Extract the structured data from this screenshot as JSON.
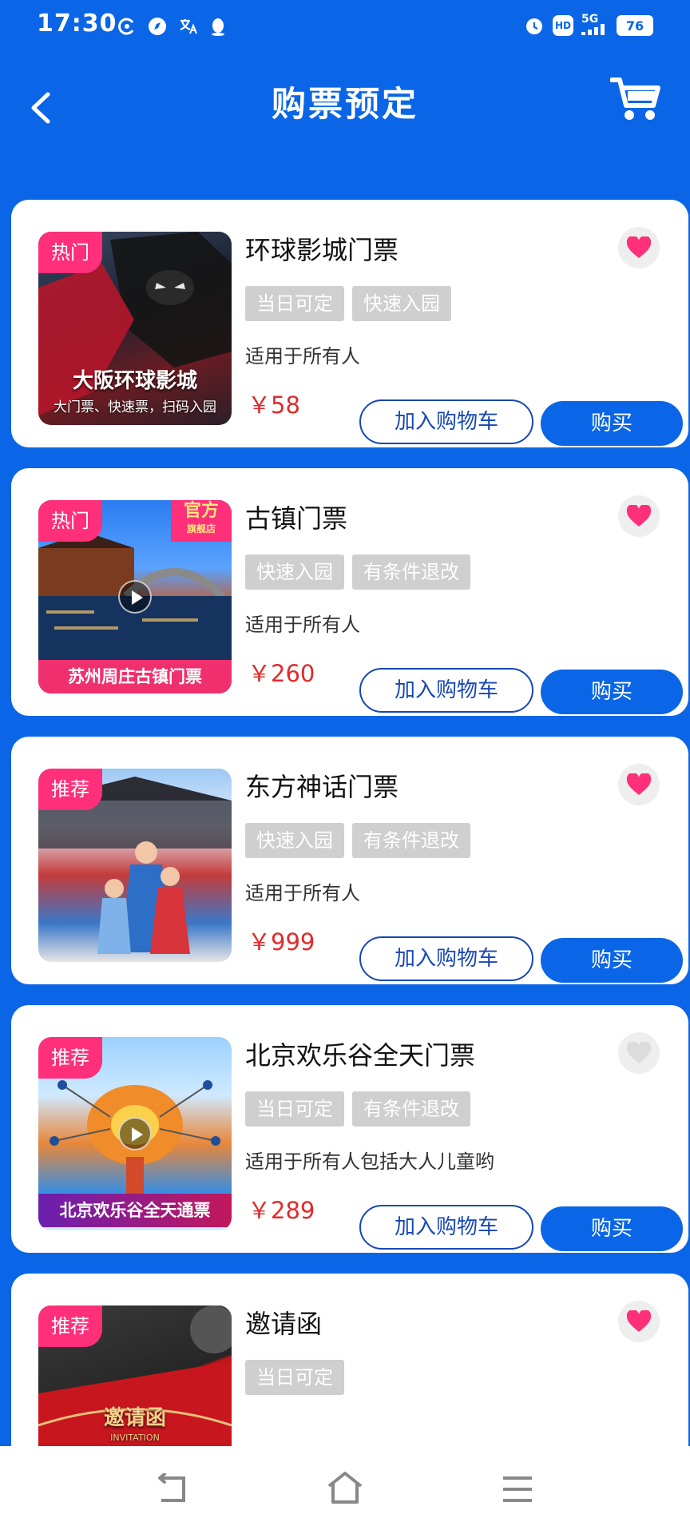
{
  "status": {
    "time": "17:30",
    "hd": "HD",
    "network": "5G",
    "battery": "76"
  },
  "header": {
    "title": "购票预定"
  },
  "tickets": [
    {
      "tag": "热门",
      "title": "环球影城门票",
      "chips": [
        "当日可定",
        "快速入园"
      ],
      "audience": "适用于所有人",
      "price": "￥58",
      "favorited": true,
      "thumb_caption": "大阪环球影城",
      "thumb_subcaption": "大门票、快速票，扫码入园",
      "add_cart_label": "加入购物车",
      "buy_label": "购买"
    },
    {
      "tag": "热门",
      "title": "古镇门票",
      "chips": [
        "快速入园",
        "有条件退改"
      ],
      "audience": "适用于所有人",
      "price": "￥260",
      "favorited": true,
      "official_badge": "官方",
      "official_badge_sub": "旗舰店",
      "thumb_banner": "苏州周庄古镇门票",
      "add_cart_label": "加入购物车",
      "buy_label": "购买"
    },
    {
      "tag": "推荐",
      "title": "东方神话门票",
      "chips": [
        "快速入园",
        "有条件退改"
      ],
      "audience": "适用于所有人",
      "price": "￥999",
      "favorited": true,
      "add_cart_label": "加入购物车",
      "buy_label": "购买"
    },
    {
      "tag": "推荐",
      "title": "北京欢乐谷全天门票",
      "chips": [
        "当日可定",
        "有条件退改"
      ],
      "audience": "适用于所有人包括大人儿童哟",
      "price": "￥289",
      "favorited": false,
      "thumb_banner": "北京欢乐谷全天通票",
      "add_cart_label": "加入购物车",
      "buy_label": "购买"
    },
    {
      "tag": "推荐",
      "title": "邀请函",
      "chips": [
        "当日可定"
      ],
      "favorited": true,
      "thumb_caption": "邀请函",
      "thumb_subcaption": "INVITATION"
    }
  ],
  "colors": {
    "primary": "#0a66e6",
    "tag": "#ff2f7a",
    "price": "#e02b2b",
    "chip": "#cfcfcf",
    "outline_button": "#1747b5"
  },
  "icons": {
    "back": "chevron-left-icon",
    "cart": "shopping-cart-icon",
    "favorite": "heart-icon"
  }
}
